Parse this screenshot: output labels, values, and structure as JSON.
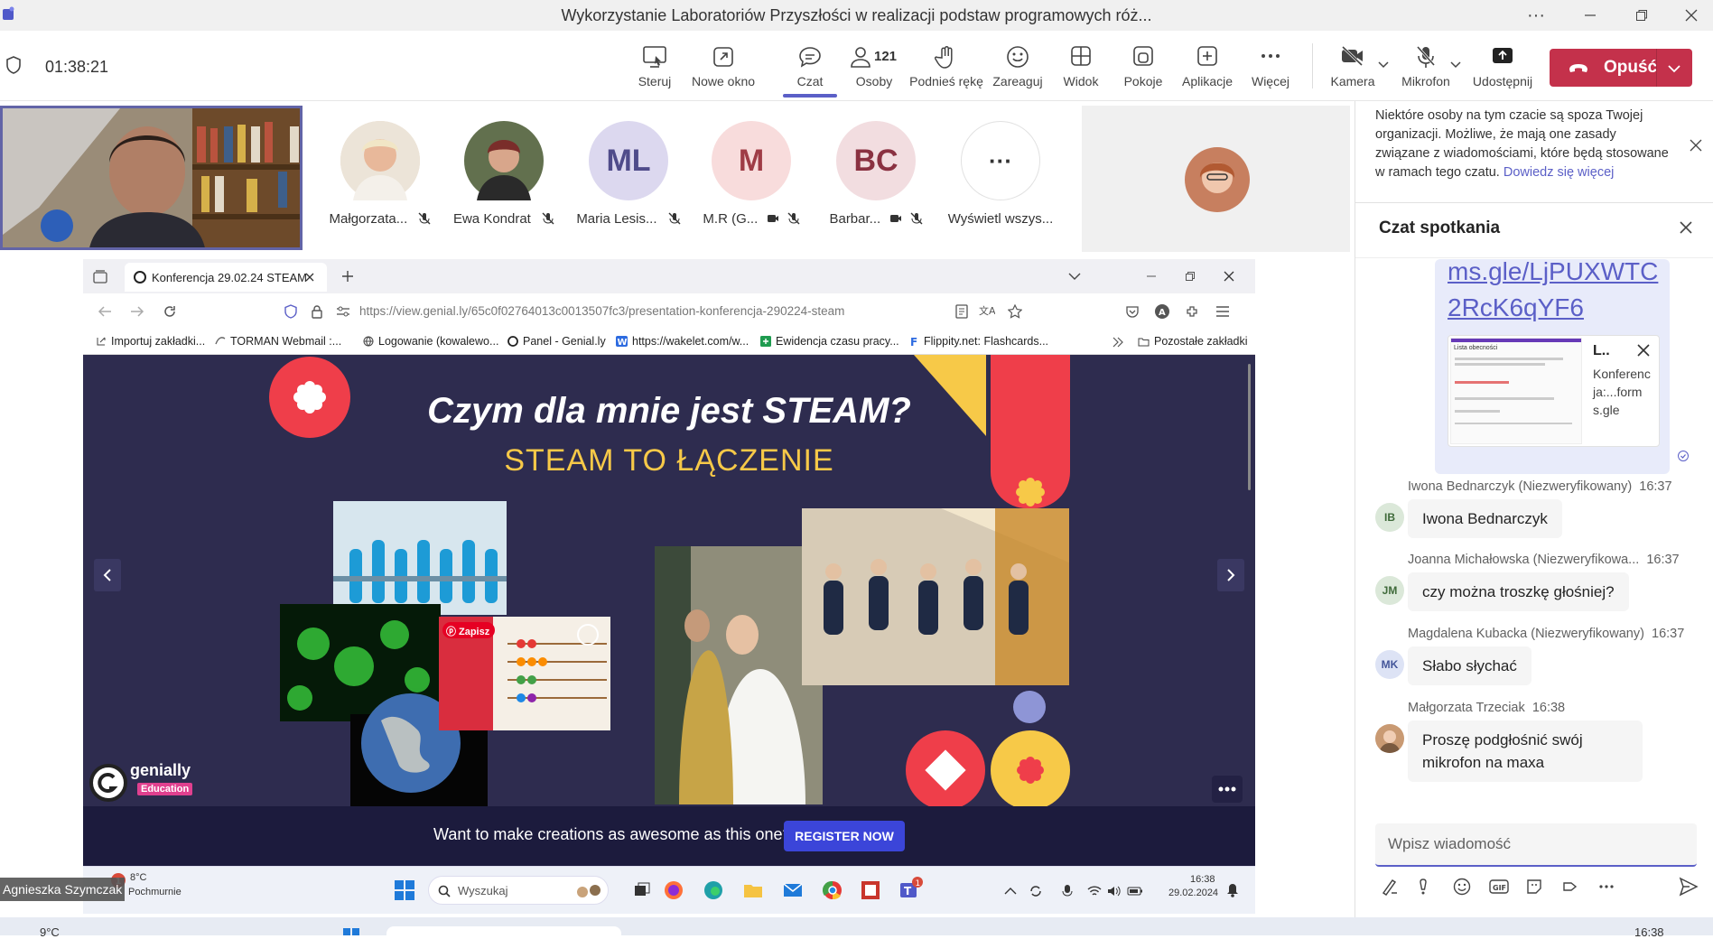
{
  "window": {
    "title": "Wykorzystanie Laboratoriów Przyszłości w realizacji podstaw programowych róż...",
    "more": "···"
  },
  "toolbar": {
    "timer": "01:38:21",
    "items": [
      {
        "label": "Steruj",
        "icon": "control-icon"
      },
      {
        "label": "Nowe okno",
        "icon": "pop-out-icon"
      },
      {
        "label": "Czat",
        "icon": "chat-icon"
      },
      {
        "label": "Osoby",
        "icon": "people-icon",
        "count": "121"
      },
      {
        "label": "Podnieś rękę",
        "icon": "raise-hand-icon"
      },
      {
        "label": "Zareaguj",
        "icon": "react-icon"
      },
      {
        "label": "Widok",
        "icon": "view-icon"
      },
      {
        "label": "Pokoje",
        "icon": "rooms-icon"
      },
      {
        "label": "Aplikacje",
        "icon": "apps-icon"
      },
      {
        "label": "Więcej",
        "icon": "more-icon"
      },
      {
        "label": "Kamera",
        "icon": "camera-off-icon"
      },
      {
        "label": "Mikrofon",
        "icon": "mic-off-icon"
      },
      {
        "label": "Udostępnij",
        "icon": "share-icon"
      }
    ],
    "leave_label": "Opuść"
  },
  "participants": [
    {
      "name": "Małgorzata...",
      "initials": "",
      "bg": "#e9d7c3",
      "fg": "#000"
    },
    {
      "name": "Ewa Kondrat",
      "initials": "",
      "bg": "#6f7a5c",
      "fg": "#000"
    },
    {
      "name": "Maria Lesis...",
      "initials": "ML",
      "bg": "#dcd8ef",
      "fg": "#4f4b8a"
    },
    {
      "name": "M.R (G...",
      "initials": "M",
      "bg": "#f8dcdc",
      "fg": "#9f3c46"
    },
    {
      "name": "Barbar...",
      "initials": "BC",
      "bg": "#f2dde0",
      "fg": "#8a3141"
    },
    {
      "name": "Wyświetl wszys...",
      "initials": "···",
      "bg": "#ffffff",
      "fg": "#333"
    }
  ],
  "presenter": {
    "name": "Agnieszka Szymczak"
  },
  "browser": {
    "tab_title": "Konferencja 29.02.24 STEAM",
    "url": "https://view.genial.ly/65c0f02764013c0013507fc3/presentation-konferencja-290224-steam",
    "bookmarks": [
      "Importuj zakładki...",
      "TORMAN Webmail :...",
      "Logowanie (kowalewo...",
      "Panel - Genial.ly",
      "https://wakelet.com/w...",
      "Ewidencja czasu pracy...",
      "Flippity.net: Flashcards..."
    ],
    "other_bookmarks": "Pozostałe zakładki"
  },
  "slide": {
    "title": "Czym dla mnie jest STEAM?",
    "subtitle": "STEAM TO ŁĄCZENIE",
    "pin_label": "Zapisz",
    "brand": "genially",
    "brand_sub": "Education"
  },
  "promo": {
    "text": "Want to make creations as awesome as this one?",
    "button": "REGISTER NOW"
  },
  "shared_taskbar": {
    "weather_temp": "8°C",
    "weather_desc": "Pochmurnie",
    "search": "Wyszukaj",
    "time": "16:38",
    "date": "29.02.2024",
    "badge": "1"
  },
  "chat": {
    "notice": "Niektóre osoby na tym czacie są spoza Twojej organizacji. Możliwe, że mają one zasady związane z wiadomościami, które będą stosowane w ramach tego czatu.",
    "notice_link": "Dowiedz się więcej",
    "header": "Czat spotkania",
    "link_text": "ms.gle/LjPUXWTC2RcK6qYF6",
    "link_card_title": "L..",
    "link_card_desc": "Konferencja:...forms.gle",
    "form_title": "Lista obecności",
    "messages": [
      {
        "author": "Iwona Bednarczyk (Niezweryfikowany)",
        "time": "16:37",
        "initials": "IB",
        "text": "Iwona Bednarczyk",
        "bg": "#dbe8d9",
        "fg": "#3f6a3a"
      },
      {
        "author": "Joanna Michałowska (Niezweryfikowa...",
        "time": "16:37",
        "initials": "JM",
        "text": "czy można troszkę głośniej?",
        "bg": "#dbe8d9",
        "fg": "#3f6a3a"
      },
      {
        "author": "Magdalena Kubacka (Niezweryfikowany)",
        "time": "16:37",
        "initials": "MK",
        "text": "Słabo słychać",
        "bg": "#dde3f5",
        "fg": "#44569a"
      },
      {
        "author": "Małgorzata Trzeciak",
        "time": "16:38",
        "initials": "",
        "text": "Proszę podgłośnić swój mikrofon na maxa",
        "bg": "#d8b89a",
        "fg": "#fff"
      }
    ],
    "compose_placeholder": "Wpisz wiadomość"
  },
  "os_taskbar": {
    "temp": "9°C",
    "time": "16:38"
  },
  "colors": {
    "teams_accent": "#5b5fc7",
    "leave": "#c4314b",
    "slide_bg": "#2e2c4f"
  }
}
